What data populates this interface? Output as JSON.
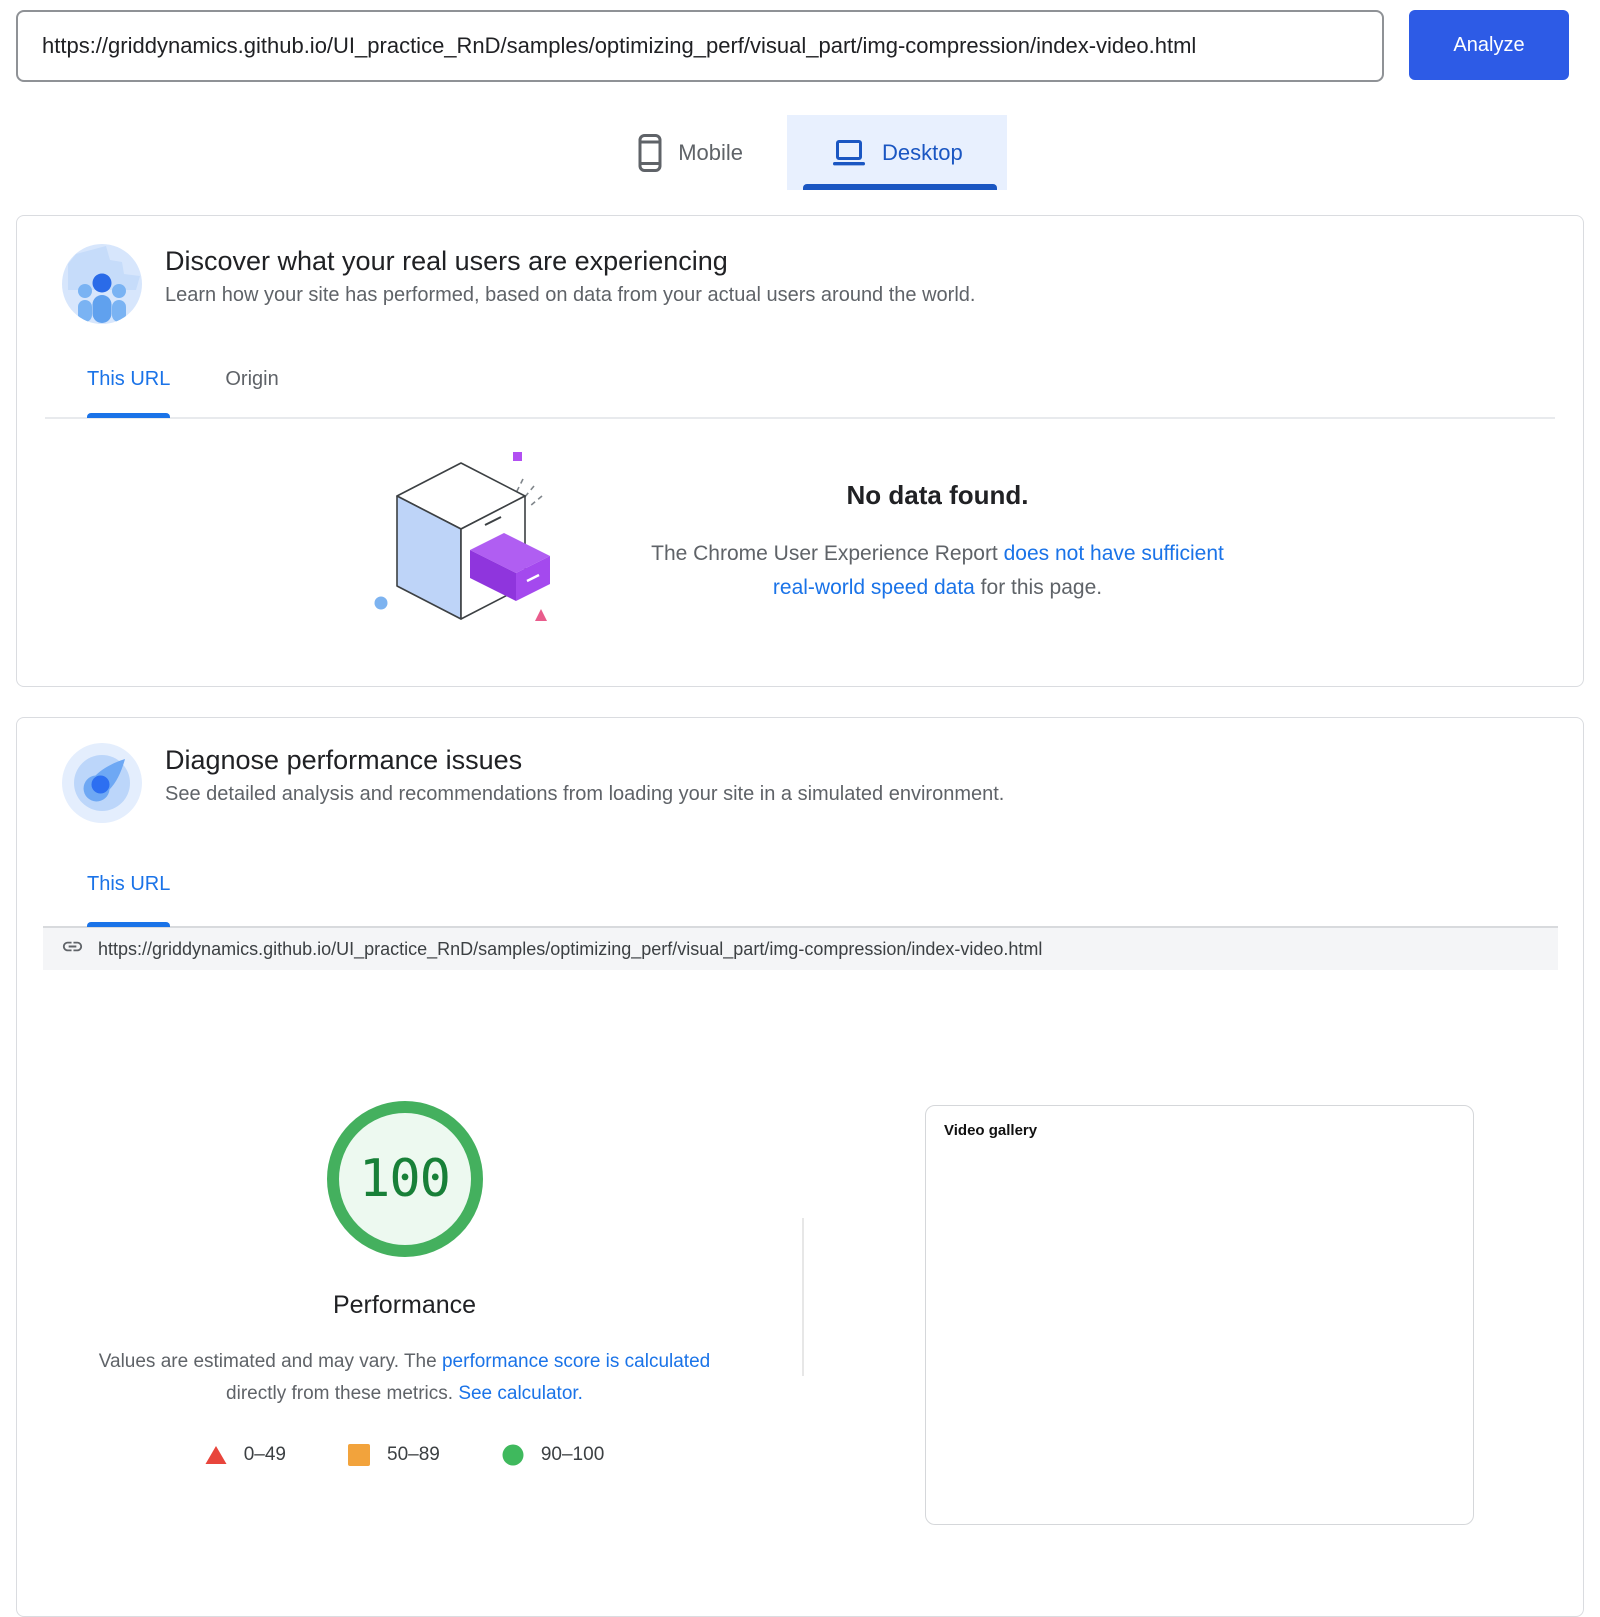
{
  "topbar": {
    "url_value": "https://griddynamics.github.io/UI_practice_RnD/samples/optimizing_perf/visual_part/img-compression/index-video.html",
    "analyze_label": "Analyze"
  },
  "device_tabs": {
    "mobile": "Mobile",
    "desktop": "Desktop"
  },
  "field_card": {
    "title": "Discover what your real users are experiencing",
    "subtitle": "Learn how your site has performed, based on data from your actual users around the world.",
    "tabs": [
      {
        "label": "This URL"
      },
      {
        "label": "Origin"
      }
    ],
    "no_data": {
      "title": "No data found.",
      "text_before": "The Chrome User Experience Report ",
      "link": "does not have sufficient real-world speed data",
      "text_after": " for this page."
    }
  },
  "lab_card": {
    "title": "Diagnose performance issues",
    "subtitle": "See detailed analysis and recommendations from loading your site in a simulated environment.",
    "tab": "This URL",
    "analyzed_url": "https://griddynamics.github.io/UI_practice_RnD/samples/optimizing_perf/visual_part/img-compression/index-video.html",
    "score": {
      "value": "100",
      "label": "Performance"
    },
    "disclaimer": {
      "text_1": "Values are estimated and may vary. The ",
      "link_1": "performance score is calculated",
      "text_2": " directly from these metrics. ",
      "link_2": "See calculator."
    },
    "legend": [
      {
        "range": "0–49",
        "shape": "triangle",
        "color": "#e8453c"
      },
      {
        "range": "50–89",
        "shape": "square",
        "color": "#f2a33c"
      },
      {
        "range": "90–100",
        "shape": "circle",
        "color": "#3fb95d"
      }
    ],
    "screenshot_label": "Video gallery"
  },
  "colors": {
    "accent_link_blue": "#1a73e8",
    "analyze_button_blue": "#2d5be6",
    "desktop_tab_blue": "#1a56c2",
    "desktop_tab_bg": "#e8f0fe",
    "score_ring_green": "#44b05e",
    "score_text_green": "#188038"
  }
}
